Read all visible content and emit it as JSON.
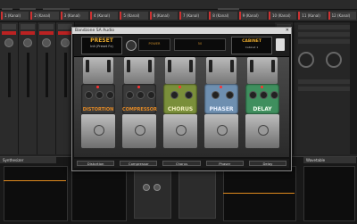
{
  "window": {
    "title": "Bandzone SA Audio"
  },
  "tracks": [
    "1 (Kanal)",
    "2 (Kanal)",
    "3 (Kanal)",
    "4 (Kanal)",
    "5 (Kanal)",
    "6 (Kanal)",
    "7 (Kanal)",
    "8 (Kanal)",
    "9 (Kanal)",
    "10 (Kanal)",
    "11 (Kanal)",
    "12 (Kanal)"
  ],
  "preset": {
    "label": "PRESET",
    "name": "Init (Preset Fx)"
  },
  "rack": {
    "power_label": "POWER",
    "volume_label": "50",
    "cabinet_label": "CABINET",
    "cabinet_name": "Cabinet 1"
  },
  "pedals": [
    {
      "name": "DISTORTION",
      "color": "#3a3a3a",
      "text": "#e48a25"
    },
    {
      "name": "COMPRESSOR",
      "color": "#3a3a3a",
      "text": "#e48a25"
    },
    {
      "name": "CHORUS",
      "color": "#7a8f3a",
      "text": "#f3f0c0"
    },
    {
      "name": "PHASER",
      "color": "#6e8fb0",
      "text": "#e9f1ff"
    },
    {
      "name": "DELAY",
      "color": "#3f8f5e",
      "text": "#f0fff0"
    }
  ],
  "labels": [
    "Distortion",
    "Compressor",
    "Chorus",
    "Phaser",
    "Delay"
  ],
  "bottom": {
    "left_header": "Synthesizer",
    "right_header": "Wavetable"
  },
  "colors": {
    "accent_orange": "#e08a1e",
    "track_red": "#cc3333"
  }
}
